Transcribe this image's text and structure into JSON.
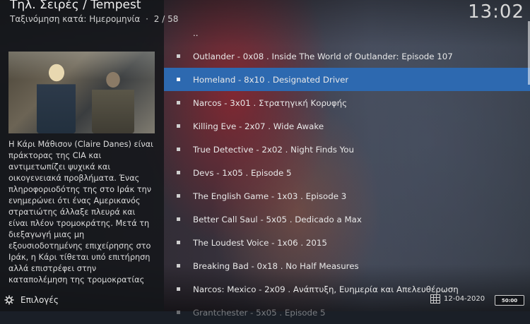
{
  "header": {
    "title": "Τηλ. Σειρές / Tempest",
    "sort_label": "Ταξινόμηση κατά: Ημερομηνία",
    "separator": "·",
    "position": "2 / 58"
  },
  "clock": "13:02",
  "plot": "Η Κάρι Μάθισον (Claire Danes) είναι πράκτορας της CIA και αντιμετωπίζει ψυχικά και οικογενειακά προβλήματα. Ένας πληροφοριοδότης της στο Ιράκ την ενημερώνει ότι ένας Αμερικανός στρατιώτης άλλαξε πλευρά και είναι πλέον τρομοκράτης. Μετά τη διεξαγωγή μιας μη εξουσιοδοτημένης επιχείρησης στο Ιράκ, η Κάρι τίθεται υπό επιτήρηση αλλά επιστρέφει στην καταπολέμηση της τρομοκρατίας",
  "list": {
    "parent": "..",
    "items": [
      "Outlander - 0x08 . Inside The World of Outlander: Episode 107",
      "Homeland - 8x10 . Designated Driver",
      "Narcos - 3x01 . Στρατηγική Κορυφής",
      "Killing Eve - 2x07 . Wide Awake",
      "True Detective - 2x02 . Night Finds You",
      "Devs - 1x05 . Episode 5",
      "The English Game - 1x03 . Episode 3",
      "Better Call Saul - 5x05 . Dedicado a Max",
      "The Loudest Voice - 1x06 . 2015",
      "Breaking Bad - 0x18 . No Half Measures",
      "Narcos: Mexico - 2x09 . Ανάπτυξη, Ευημερία και Απελευθέρωση",
      "Grantchester - 5x05 . Episode 5"
    ],
    "selected_index": 1
  },
  "footer": {
    "options_label": "Επιλογές",
    "date": "12-04-2020",
    "duration": "50:00"
  },
  "colors": {
    "selection": "#2d69b0"
  },
  "icons": {
    "options": "gear-icon",
    "date": "calendar-icon"
  }
}
